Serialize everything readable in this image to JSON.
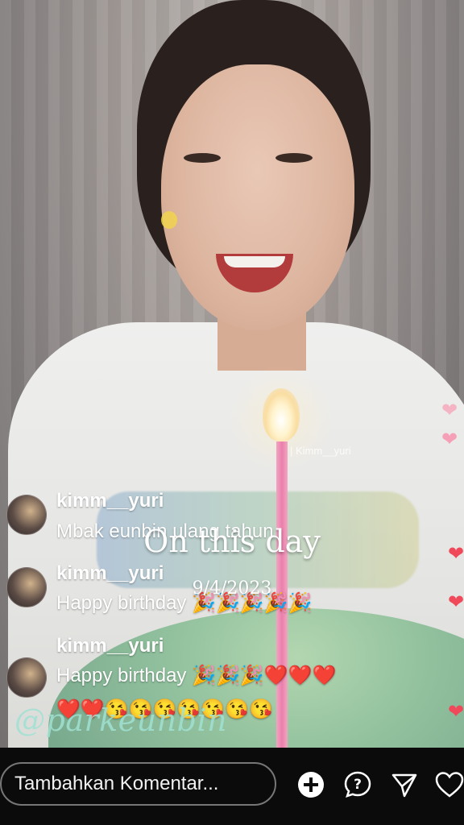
{
  "stream": {
    "broadcast_tag": "| Kimm__yuri"
  },
  "comments": [
    {
      "username": "kimm__yuri",
      "text": "Mbak eunbin ulang tahun"
    },
    {
      "username": "kimm__yuri",
      "text": "Happy birthday",
      "emojis": "🎉🎉🎉🎉🎉"
    },
    {
      "username": "kimm__yuri",
      "text": "Happy birthday",
      "emojis": "🎉🎉🎉❤️❤️❤️",
      "line2": "❤️❤️😘😘😘😘😘😘😘"
    }
  ],
  "overlay": {
    "title": "On this day",
    "date": "9/4/2023",
    "watermark": "@parkeunbin"
  },
  "comment_input": {
    "placeholder": "Tambahkan Komentar..."
  },
  "actions": {
    "add_icon": "plus-circle-icon",
    "question_icon": "question-icon",
    "share_icon": "send-icon",
    "like_icon": "heart-outline-icon"
  },
  "colors": {
    "bar_background": "#0b0b0b",
    "heart": "#f04a5a",
    "watermark": "#a0e1d2"
  }
}
